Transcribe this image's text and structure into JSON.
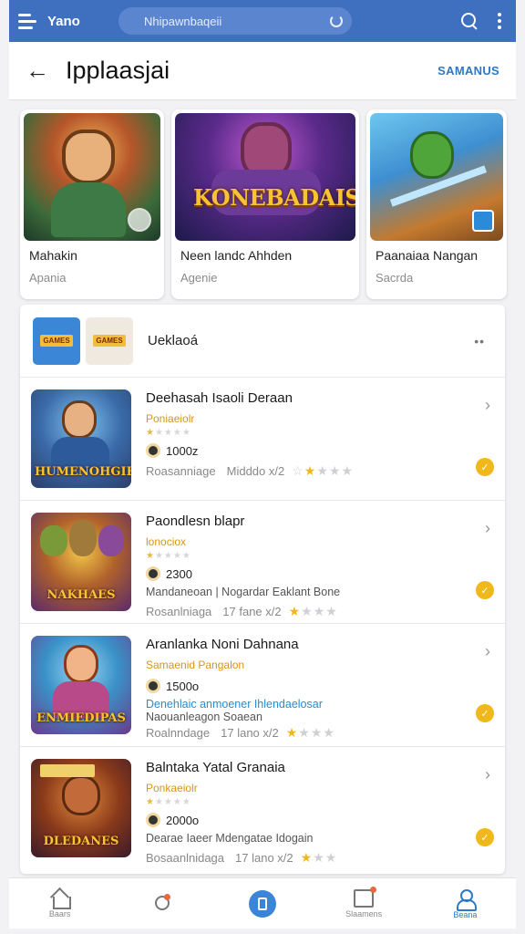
{
  "topbar": {
    "brand": "Yano",
    "search_value": "Nhipawnbaqeii",
    "icons": [
      "menu-icon",
      "refresh-icon",
      "search-icon",
      "more-vert-icon"
    ]
  },
  "header": {
    "title": "Ipplaasjai",
    "action_label": "SAMANUS"
  },
  "featured": [
    {
      "name": "Mahakin",
      "sub": "Apania",
      "logo": ""
    },
    {
      "name": "Neen landc Ahhden",
      "sub": "Agenie",
      "logo": "KONEBADAIS"
    },
    {
      "name": "Paanaiaa Nangan",
      "sub": "Sacrda",
      "logo": ""
    }
  ],
  "category": {
    "label": "Ueklaoá",
    "more": "••",
    "thumbs": [
      "GAMES",
      "GAMES"
    ]
  },
  "apps": [
    {
      "title": "Deehasah Isaoli Deraan",
      "category": "Poniaeiolr",
      "downloads": "1000z",
      "extra": "",
      "meta_label": "Roasanniage",
      "size": "Midddo x/2",
      "rating": 1,
      "thumb_logo": "HUMENOHGIER"
    },
    {
      "title": "Paondlesn blapr",
      "category": "lonociox",
      "downloads": "2300",
      "extra": "Mandaneoan | Nogardar Eaklant Bone",
      "meta_label": "Rosanlniaga",
      "size": "17 fane x/2",
      "rating": 1,
      "thumb_logo": "NAKHAES"
    },
    {
      "title": "Aranlanka Noni Dahnana",
      "category": "Samaenid Pangalon",
      "downloads": "1500o",
      "extra": "Denehlaic anmoener Ihlendaelosar",
      "extra2": "Naouanleagon Soaean",
      "meta_label": "Roalnndage",
      "size": "17 lano x/2",
      "rating": 1,
      "thumb_logo": "ENMIEDIPAS"
    },
    {
      "title": "Balntaka Yatal Granaia",
      "category": "Ponkaeiolr",
      "downloads": "2000o",
      "extra": "Dearae Iaeer Mdengatae Idogain",
      "meta_label": "Bosaanlnidaga",
      "size": "17 lano x/2",
      "rating": 1,
      "thumb_logo": "DLEDANES"
    }
  ],
  "bottom_nav": [
    {
      "label": "Baars",
      "icon": "home-icon"
    },
    {
      "label": "",
      "icon": "explore-icon"
    },
    {
      "label": "",
      "icon": "library-icon"
    },
    {
      "label": "Slaamens",
      "icon": "updates-icon"
    },
    {
      "label": "Beana",
      "icon": "profile-icon"
    }
  ],
  "colors": {
    "topbar": "#3f6fbf",
    "accent": "#2c78c9",
    "category": "#d7961a",
    "star": "#efb71a"
  }
}
